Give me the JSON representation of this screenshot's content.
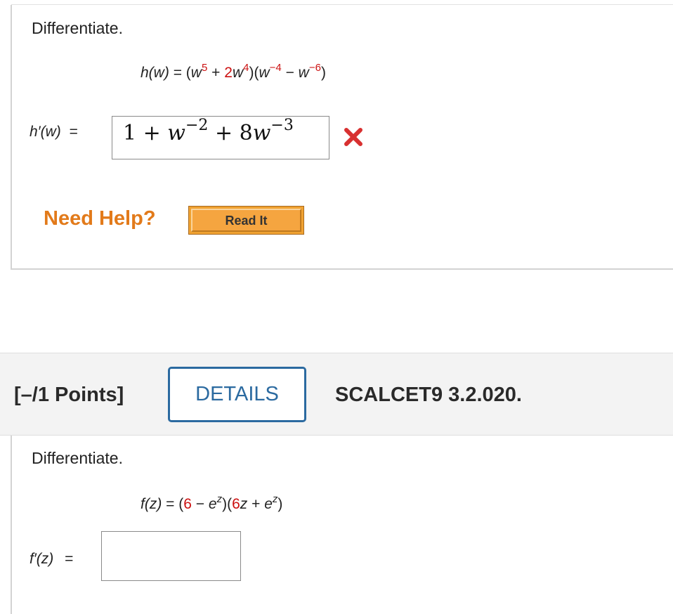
{
  "problem1": {
    "instruction": "Differentiate.",
    "function": {
      "lhs": "h(w)",
      "eq": "=",
      "open": "(",
      "w1": "w",
      "exp1": "5",
      "plus": " + ",
      "coef": "2",
      "w2": "w",
      "exp2": "4",
      "mid": ")(",
      "w3": "w",
      "exp3": "−4",
      "minus": " − ",
      "w4": "w",
      "exp4": "−6",
      "close": ")"
    },
    "answer_label": "h′(w)",
    "answer_eq": "=",
    "answer": {
      "t1": "1 + ",
      "w1": "w",
      "e1": "−2",
      "t2": " + 8",
      "w2": "w",
      "e2": "−3"
    },
    "status_icon": "incorrect-x-icon",
    "need_help": "Need Help?",
    "read_it": "Read It"
  },
  "problem2": {
    "points": "[–/1 Points]",
    "details": "DETAILS",
    "reference": "SCALCET9 3.2.020.",
    "instruction": "Differentiate.",
    "function": {
      "lhs": "f(z)",
      "eq": "=",
      "open": "(",
      "c1": "6",
      "minus": " − ",
      "e1": "e",
      "z1": "z",
      "mid": ")(",
      "c2": "6",
      "z2": "z",
      "plus": " + ",
      "e2": "e",
      "z3": "z",
      "close": ")"
    },
    "answer_label": "f′(z)",
    "answer_eq": "=",
    "answer_value": ""
  },
  "colors": {
    "accent_red": "#cc1111",
    "help_orange": "#e27a1a",
    "details_blue": "#2b6aa0",
    "button_orange": "#f0a232"
  }
}
